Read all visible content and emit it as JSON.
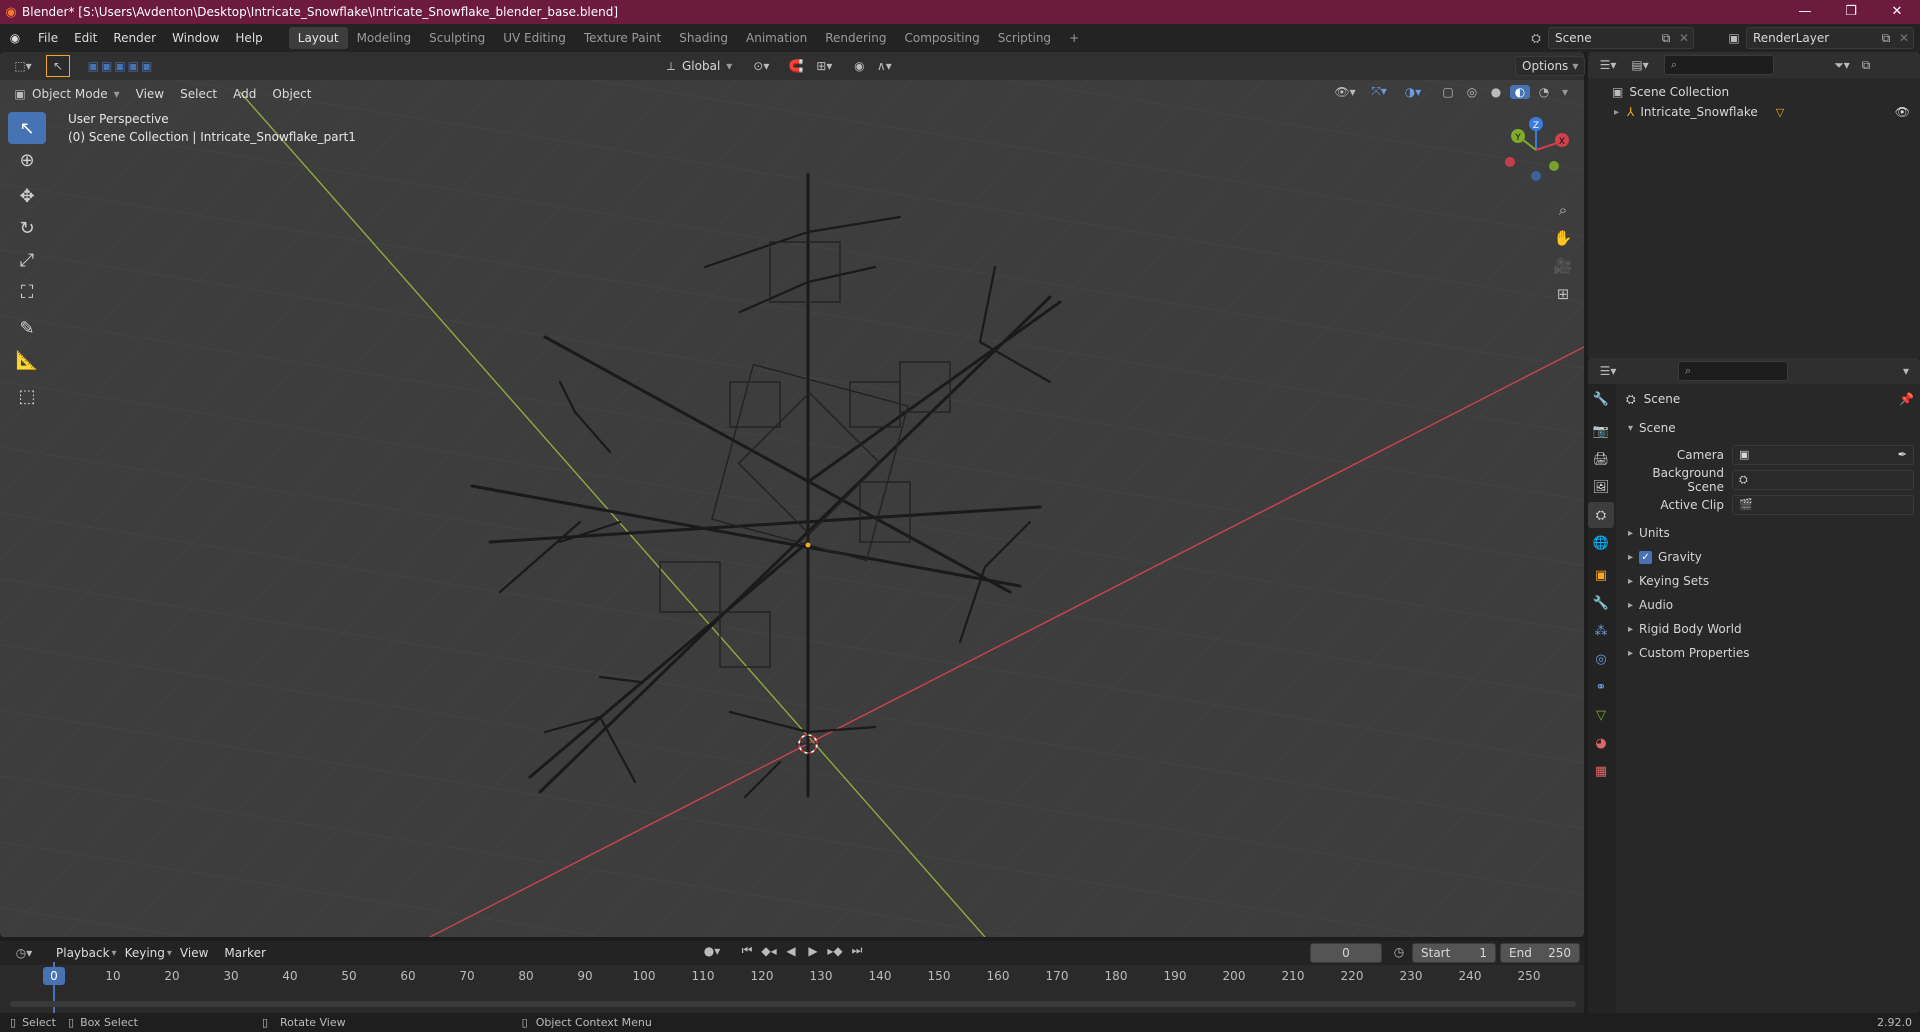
{
  "window": {
    "title": "Blender* [S:\\Users\\Avdenton\\Desktop\\Intricate_Snowflake\\Intricate_Snowflake_blender_base.blend]",
    "minimize": "—",
    "maximize": "❐",
    "close": "✕"
  },
  "menu": [
    "File",
    "Edit",
    "Render",
    "Window",
    "Help"
  ],
  "workspaces": [
    {
      "label": "Layout",
      "active": true
    },
    {
      "label": "Modeling",
      "active": false
    },
    {
      "label": "Sculpting",
      "active": false
    },
    {
      "label": "UV Editing",
      "active": false
    },
    {
      "label": "Texture Paint",
      "active": false
    },
    {
      "label": "Shading",
      "active": false
    },
    {
      "label": "Animation",
      "active": false
    },
    {
      "label": "Rendering",
      "active": false
    },
    {
      "label": "Compositing",
      "active": false
    },
    {
      "label": "Scripting",
      "active": false
    }
  ],
  "add_workspace": "+",
  "scene_selector": {
    "value": "Scene"
  },
  "renderlayer_selector": {
    "value": "RenderLayer"
  },
  "viewport_header": {
    "transform_orientation": "Global",
    "options": "Options"
  },
  "viewport_menu": {
    "mode": "Object Mode",
    "items": [
      "View",
      "Select",
      "Add",
      "Object"
    ]
  },
  "viewport_overlay": {
    "perspective": "User Perspective",
    "collection": "(0) Scene Collection | Intricate_Snowflake_part1"
  },
  "gizmo": {
    "x": "X",
    "y": "Y",
    "z": "Z"
  },
  "outliner": {
    "root": "Scene Collection",
    "items": [
      {
        "label": "Intricate_Snowflake"
      }
    ]
  },
  "properties": {
    "header": "Scene",
    "section": "Scene",
    "fields": [
      {
        "label": "Camera",
        "value": ""
      },
      {
        "label": "Background Scene",
        "value": ""
      },
      {
        "label": "Active Clip",
        "value": ""
      }
    ],
    "panels": [
      {
        "label": "Units",
        "checkbox": false
      },
      {
        "label": "Gravity",
        "checkbox": true
      },
      {
        "label": "Keying Sets",
        "checkbox": false
      },
      {
        "label": "Audio",
        "checkbox": false
      },
      {
        "label": "Rigid Body World",
        "checkbox": false
      },
      {
        "label": "Custom Properties",
        "checkbox": false
      }
    ]
  },
  "timeline": {
    "menus": [
      "Playback",
      "Keying",
      "View",
      "Marker"
    ],
    "current_frame": "0",
    "start_label": "Start",
    "start": "1",
    "end_label": "End",
    "end": "250",
    "ticks": [
      "0",
      "10",
      "20",
      "30",
      "40",
      "50",
      "60",
      "70",
      "80",
      "90",
      "100",
      "110",
      "120",
      "130",
      "140",
      "150",
      "160",
      "170",
      "180",
      "190",
      "200",
      "210",
      "220",
      "230",
      "240",
      "250"
    ]
  },
  "statusbar": {
    "select": "Select",
    "box_select": "Box Select",
    "rotate_view": "Rotate View",
    "context_menu": "Object Context Menu",
    "version": "2.92.0"
  },
  "colors": {
    "title_bar": "#6d1a3f",
    "accent": "#4772b3",
    "x_axis": "#c94450",
    "y_axis": "#8cab3e",
    "origin": "#f5a623"
  }
}
